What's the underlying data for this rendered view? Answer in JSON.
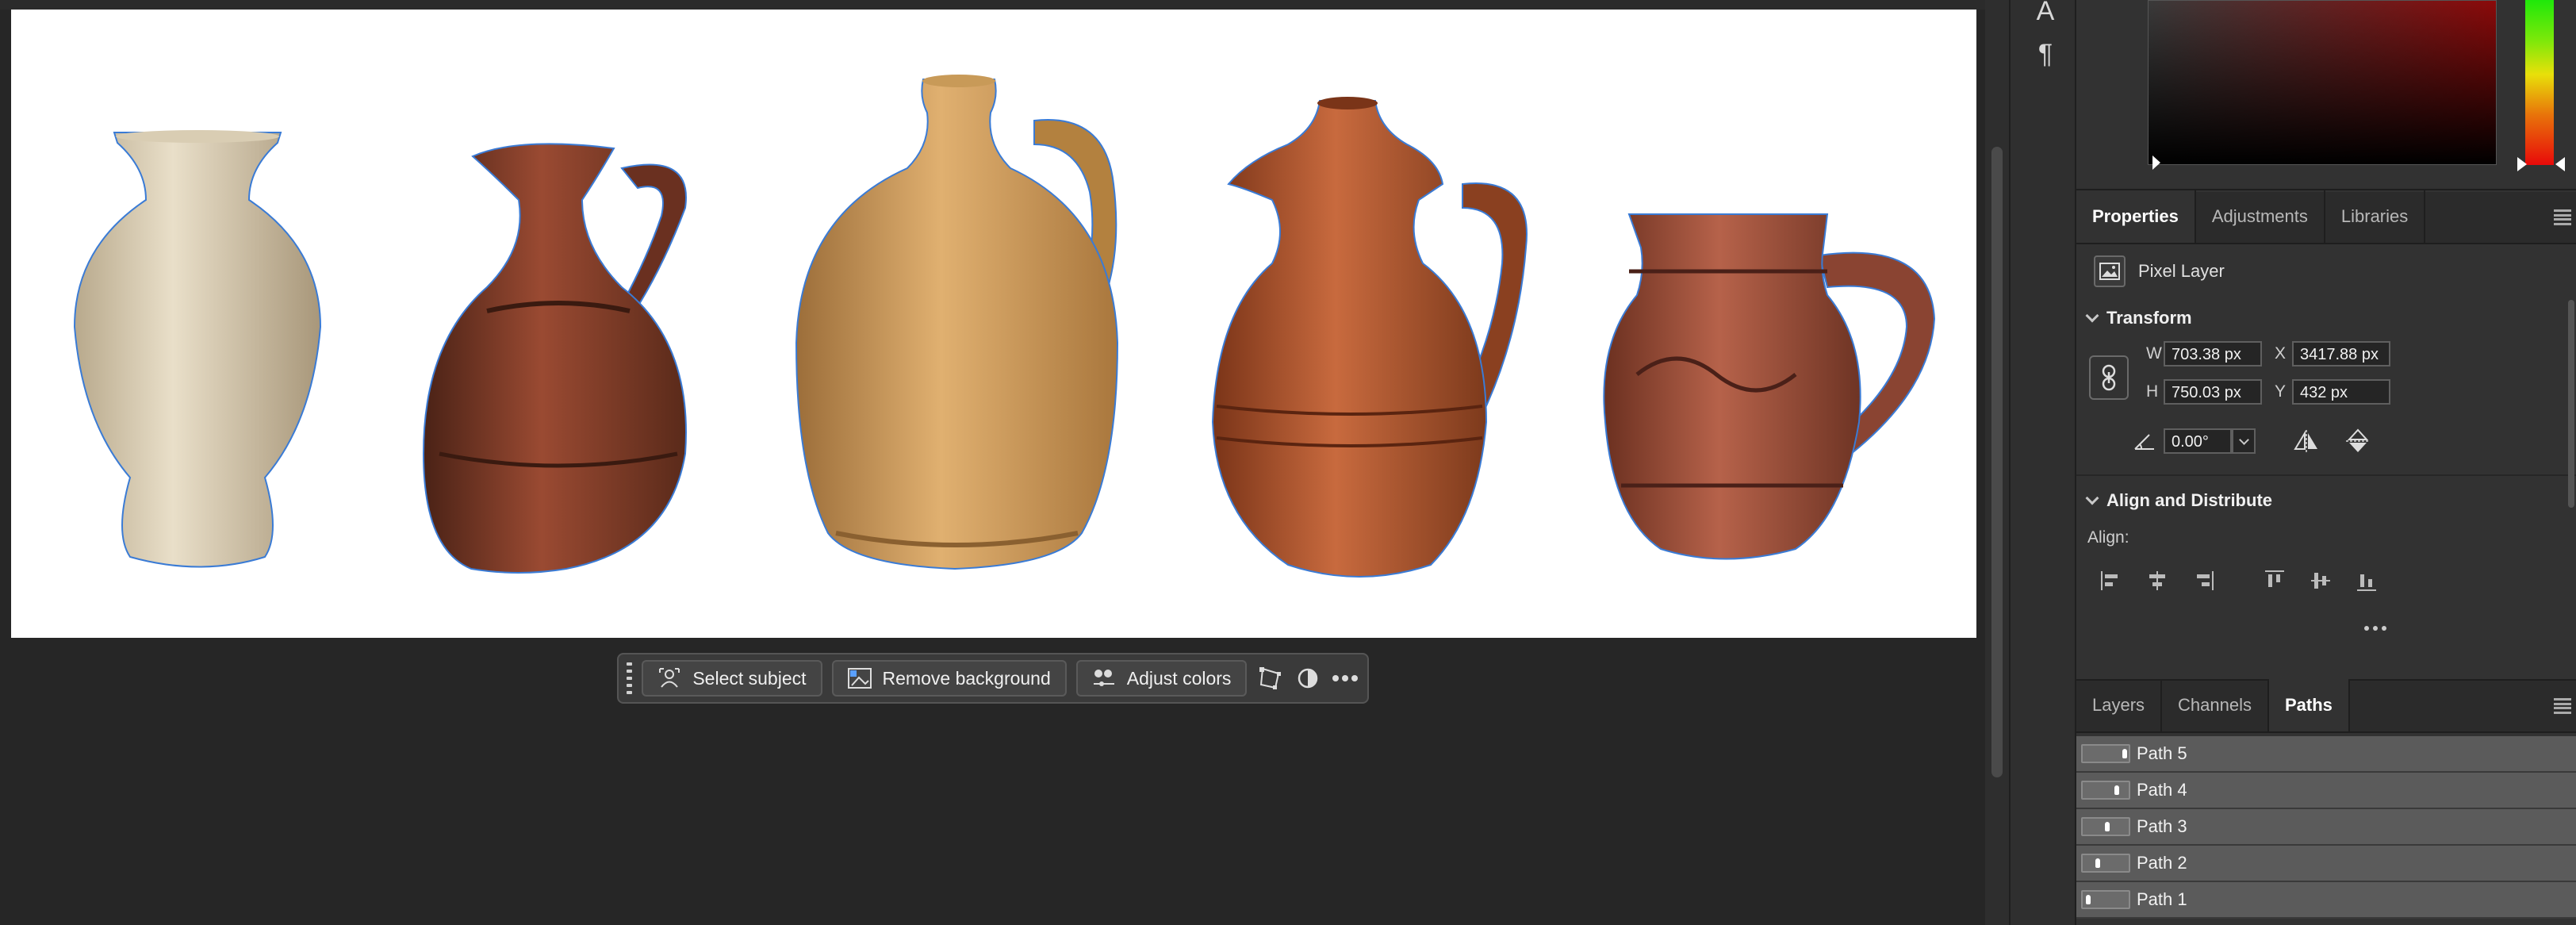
{
  "taskbar": {
    "select_subject": "Select subject",
    "remove_background": "Remove background",
    "adjust_colors": "Adjust colors",
    "icons": [
      "grip-icon",
      "select-subject-icon",
      "remove-background-icon",
      "adjust-colors-icon",
      "transform-icon",
      "mask-icon",
      "more-icon"
    ]
  },
  "colors": {
    "panel_bg": "#323232",
    "canvas_bg": "#262626",
    "selection_outline": "#3a7bd5",
    "active_path_row": "#5b5b5b"
  },
  "properties_panel": {
    "tabs": [
      {
        "label": "Properties",
        "active": true
      },
      {
        "label": "Adjustments",
        "active": false
      },
      {
        "label": "Libraries",
        "active": false
      }
    ],
    "layer_kind": "Pixel Layer",
    "transform": {
      "title": "Transform",
      "w_label": "W",
      "w_value": "703.38 px",
      "h_label": "H",
      "h_value": "750.03 px",
      "x_label": "X",
      "x_value": "3417.88 px",
      "y_label": "Y",
      "y_value": "432 px",
      "angle_value": "0.00°"
    },
    "align": {
      "title": "Align and Distribute",
      "label": "Align:"
    }
  },
  "paths_panel": {
    "tabs": [
      {
        "label": "Layers",
        "active": false
      },
      {
        "label": "Channels",
        "active": false
      },
      {
        "label": "Paths",
        "active": true
      }
    ],
    "paths": [
      "Path 5",
      "Path 4",
      "Path 3",
      "Path 2",
      "Path 1"
    ]
  }
}
